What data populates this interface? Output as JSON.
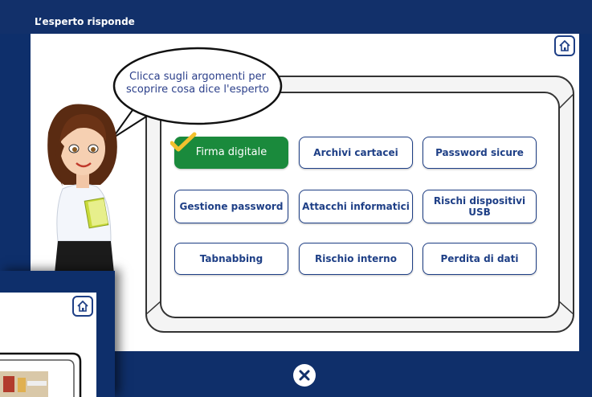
{
  "header": {
    "title": "L’esperto risponde"
  },
  "bubble": {
    "text": "Clicca sugli argomenti per scoprire cosa dice l'esperto"
  },
  "topics": [
    {
      "label": "Firma digitale",
      "active": true
    },
    {
      "label": "Archivi cartacei",
      "active": false
    },
    {
      "label": "Password sicure",
      "active": false
    },
    {
      "label": "Gestione password",
      "active": false
    },
    {
      "label": "Attacchi informatici",
      "active": false
    },
    {
      "label": "Rischi dispositivi USB",
      "active": false
    },
    {
      "label": "Tabnabbing",
      "active": false
    },
    {
      "label": "Rischio interno",
      "active": false
    },
    {
      "label": "Perdita di dati",
      "active": false
    }
  ],
  "icons": {
    "home": "home-icon",
    "close": "close-icon",
    "check": "checkmark-icon"
  },
  "colors": {
    "navy": "#12306a",
    "active_green": "#1a8a3c",
    "check_yellow": "#f2c12e",
    "text_blue": "#1e3f86"
  }
}
